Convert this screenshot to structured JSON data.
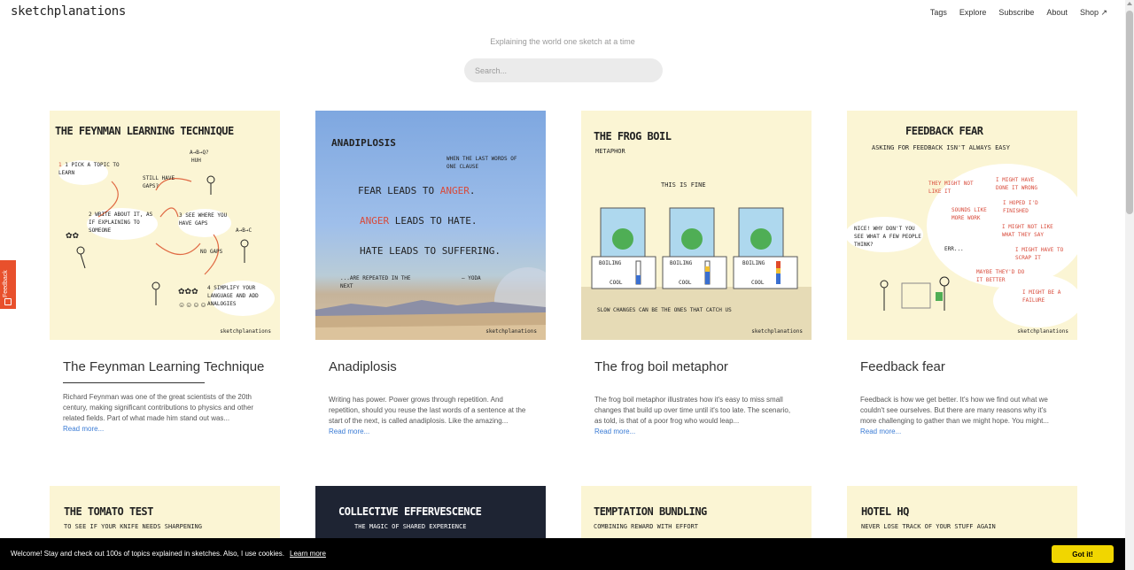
{
  "header": {
    "logo": "sketchplanations",
    "nav": [
      "Tags",
      "Explore",
      "Subscribe",
      "About",
      "Shop ↗"
    ],
    "tagline": "Explaining the world one sketch at a time",
    "search_placeholder": "Search..."
  },
  "feedback_tab": {
    "label": "Feedback"
  },
  "cards": [
    {
      "title": "The Feynman Learning Technique",
      "excerpt": "Richard Feynman was one of the great scientists of the 20th century, making significant contributions to physics and other related fields. Part of what made him stand out was...",
      "read_more": "Read more...",
      "sketch": {
        "heading": "THE FEYNMAN LEARNING TECHNIQUE",
        "step1": "1 PICK A TOPIC TO LEARN",
        "step2": "2 WRITE ABOUT IT, AS IF EXPLAINING TO SOMEONE",
        "step3": "3 SEE WHERE YOU HAVE GAPS",
        "step4": "4 SIMPLIFY YOUR LANGUAGE AND ADD ANALOGIES",
        "still": "STILL HAVE GAPS?",
        "nogaps": "NO GAPS",
        "abq": "A→B→Q?",
        "huh": "HUH",
        "abc": "A→B→C",
        "signature": "sketchplanations"
      }
    },
    {
      "title": "Anadiplosis",
      "excerpt": "Writing has power. Power grows through repetition. And repetition, should you reuse the last words of a sentence at the start of the next, is called anadiplosis. Like the amazing...",
      "read_more": "Read more...",
      "sketch": {
        "heading": "ANADIPLOSIS",
        "note": "WHEN THE LAST WORDS OF ONE CLAUSE",
        "line1a": "FEAR LEADS TO",
        "line1b": "ANGER",
        "line2a": "ANGER",
        "line2b": "LEADS TO HATE.",
        "line3": "HATE LEADS TO SUFFERING.",
        "repeated": "...ARE REPEATED IN THE NEXT",
        "yoda": "— YODA",
        "signature": "sketchplanations"
      }
    },
    {
      "title": "The frog boil metaphor",
      "excerpt": "The frog boil metaphor illustrates how it's easy to miss small changes that build up over time until it's too late. The scenario, as told, is that of a poor frog who would leap...",
      "read_more": "Read more...",
      "sketch": {
        "heading": "THE FROG BOIL",
        "subheading": "METAPHOR",
        "fine": "THIS IS FINE",
        "boiling": "BOILING",
        "cool": "COOL",
        "caption": "SLOW CHANGES CAN BE THE ONES THAT CATCH US",
        "signature": "sketchplanations"
      }
    },
    {
      "title": "Feedback fear",
      "excerpt": "Feedback is how we get better. It's how we find out what we couldn't see ourselves. But there are many reasons why it's more challenging to gather than we might hope. You might...",
      "read_more": "Read more...",
      "sketch": {
        "heading": "FEEDBACK FEAR",
        "subheading": "ASKING FOR FEEDBACK ISN'T ALWAYS EASY",
        "t1": "THEY MIGHT NOT LIKE IT",
        "t2": "I MIGHT HAVE DONE IT WRONG",
        "t3": "I HOPED I'D FINISHED",
        "t4": "SOUNDS LIKE MORE WORK",
        "t5": "I MIGHT NOT LIKE WHAT THEY SAY",
        "t6": "I MIGHT HAVE TO SCRAP IT",
        "t7": "MAYBE THEY'D DO IT BETTER",
        "t8": "I MIGHT BE A FAILURE",
        "speech1": "NICE! WHY DON'T YOU SEE WHAT A FEW PEOPLE THINK?",
        "speech2": "ERR...",
        "signature": "sketchplanations"
      }
    }
  ],
  "row2": [
    {
      "heading": "THE TOMATO TEST",
      "subheading": "TO SEE IF YOUR KNIFE NEEDS SHARPENING"
    },
    {
      "heading": "COLLECTIVE EFFERVESCENCE",
      "subheading": "THE MAGIC OF SHARED EXPERIENCE"
    },
    {
      "heading": "TEMPTATION BUNDLING",
      "subheading": "COMBINING REWARD WITH EFFORT"
    },
    {
      "heading": "HOTEL HQ",
      "subheading": "NEVER LOSE TRACK OF YOUR STUFF AGAIN"
    }
  ],
  "cookie": {
    "message": "Welcome! Stay and check out 100s of topics explained in sketches. Also, I use cookies.",
    "link": "Learn more",
    "button": "Got it!"
  }
}
